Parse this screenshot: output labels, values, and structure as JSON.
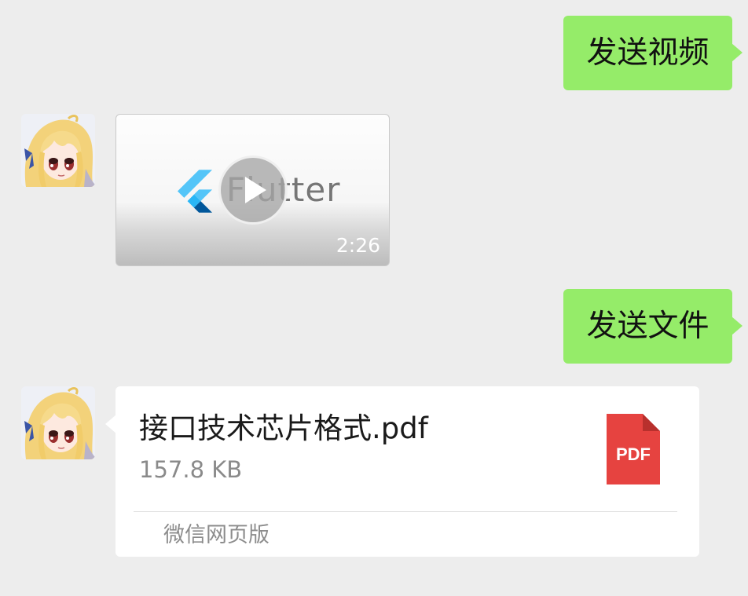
{
  "colors": {
    "background": "#ededed",
    "outgoing_bubble": "#95ec69",
    "card": "#ffffff",
    "pdf_icon": "#e64340",
    "secondary_text": "#8a8a8a"
  },
  "messages": [
    {
      "direction": "outgoing",
      "type": "text",
      "text": "发送视频"
    },
    {
      "direction": "incoming",
      "type": "video",
      "sender_avatar_icon": "anime-girl-avatar",
      "thumbnail_logo_icon": "flutter-logo-icon",
      "thumbnail_text": "Flutter",
      "play_icon": "play-icon",
      "duration": "2:26"
    },
    {
      "direction": "outgoing",
      "type": "text",
      "text": "发送文件"
    },
    {
      "direction": "incoming",
      "type": "file",
      "sender_avatar_icon": "anime-girl-avatar",
      "file_name": "接口技术芯片格式.pdf",
      "file_size": "157.8 KB",
      "file_icon": "pdf-file-icon",
      "file_icon_label": "PDF",
      "source": "微信网页版"
    }
  ]
}
